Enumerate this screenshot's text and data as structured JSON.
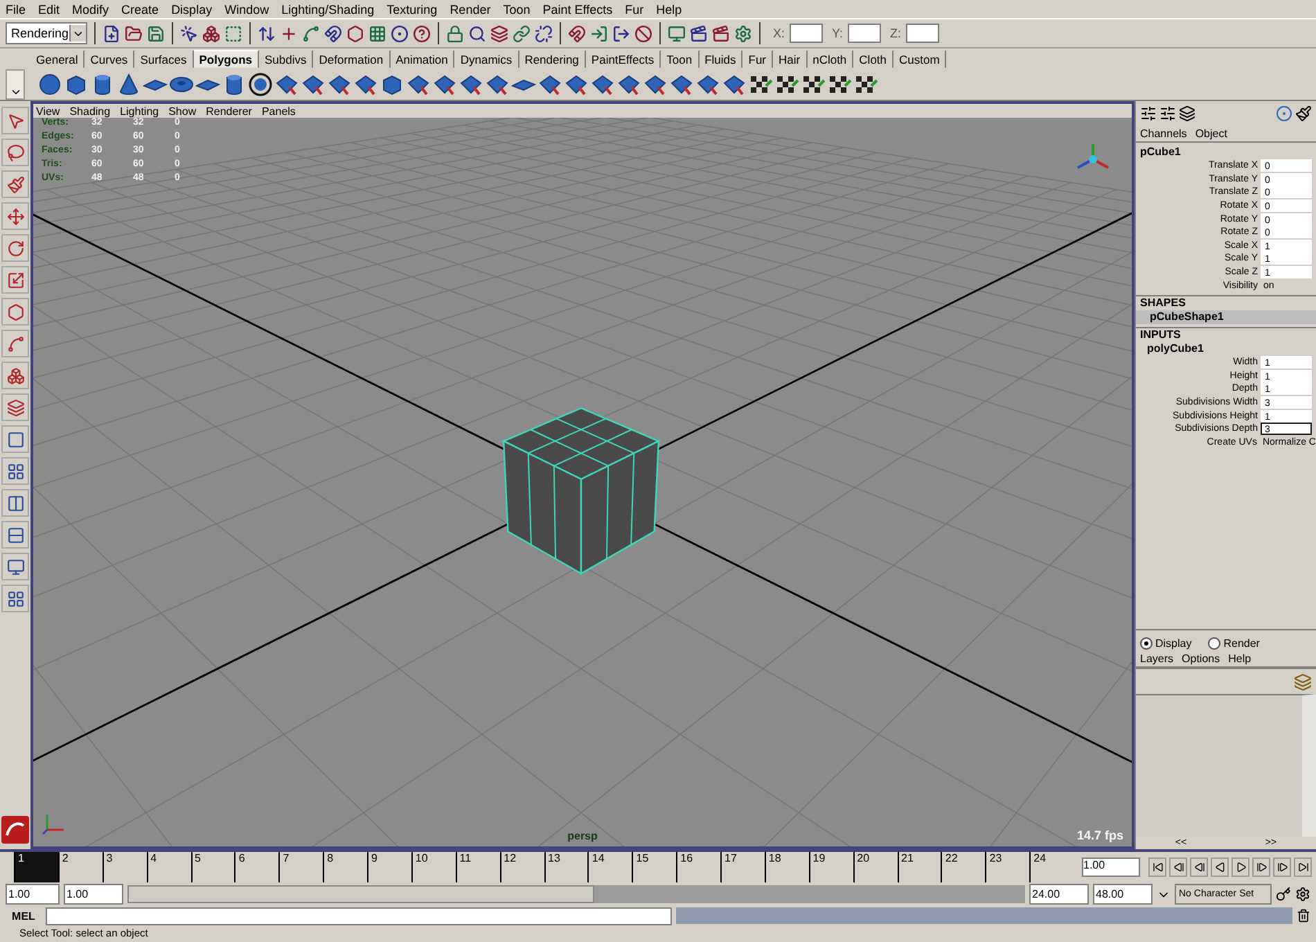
{
  "menu_bar": [
    "File",
    "Edit",
    "Modify",
    "Create",
    "Display",
    "Window",
    "Lighting/Shading",
    "Texturing",
    "Render",
    "Toon",
    "Paint Effects",
    "Fur",
    "Help"
  ],
  "status_line": {
    "mode": "Rendering",
    "coord_labels": [
      "X:",
      "Y:",
      "Z:"
    ]
  },
  "shelf_tabs": [
    {
      "label": "General",
      "selected": false
    },
    {
      "label": "Curves",
      "selected": false
    },
    {
      "label": "Surfaces",
      "selected": false
    },
    {
      "label": "Polygons",
      "selected": true
    },
    {
      "label": "Subdivs",
      "selected": false
    },
    {
      "label": "Deformation",
      "selected": false
    },
    {
      "label": "Animation",
      "selected": false
    },
    {
      "label": "Dynamics",
      "selected": false
    },
    {
      "label": "Rendering",
      "selected": false
    },
    {
      "label": "PaintEffects",
      "selected": false
    },
    {
      "label": "Toon",
      "selected": false
    },
    {
      "label": "Fluids",
      "selected": false
    },
    {
      "label": "Fur",
      "selected": false
    },
    {
      "label": "Hair",
      "selected": false
    },
    {
      "label": "nCloth",
      "selected": false
    },
    {
      "label": "Cloth",
      "selected": false
    },
    {
      "label": "Custom",
      "selected": false
    }
  ],
  "viewport": {
    "menu": [
      "View",
      "Shading",
      "Lighting",
      "Show",
      "Renderer",
      "Panels"
    ],
    "stats": [
      {
        "label": "Verts:",
        "values": [
          "32",
          "32",
          "0"
        ]
      },
      {
        "label": "Edges:",
        "values": [
          "60",
          "60",
          "0"
        ]
      },
      {
        "label": "Faces:",
        "values": [
          "30",
          "30",
          "0"
        ]
      },
      {
        "label": "Tris:",
        "values": [
          "60",
          "60",
          "0"
        ]
      },
      {
        "label": "UVs:",
        "values": [
          "48",
          "48",
          "0"
        ]
      }
    ],
    "camera": "persp",
    "fps": "14.7 fps"
  },
  "channel_box": {
    "menu": [
      "Channels",
      "Object"
    ],
    "node": "pCube1",
    "attributes": [
      {
        "label": "Translate X",
        "value": "0"
      },
      {
        "label": "Translate Y",
        "value": "0"
      },
      {
        "label": "Translate Z",
        "value": "0"
      },
      {
        "label": "Rotate X",
        "value": "0"
      },
      {
        "label": "Rotate Y",
        "value": "0"
      },
      {
        "label": "Rotate Z",
        "value": "0"
      },
      {
        "label": "Scale X",
        "value": "1"
      },
      {
        "label": "Scale Y",
        "value": "1"
      },
      {
        "label": "Scale Z",
        "value": "1"
      },
      {
        "label": "Visibility",
        "value": "on"
      }
    ],
    "shapes_header": "SHAPES",
    "shape": "pCubeShape1",
    "inputs_header": "INPUTS",
    "input_node": "polyCube1",
    "input_attributes": [
      {
        "label": "Width",
        "value": "1",
        "selected": false
      },
      {
        "label": "Height",
        "value": "1",
        "selected": false
      },
      {
        "label": "Depth",
        "value": "1",
        "selected": false
      },
      {
        "label": "Subdivisions Width",
        "value": "3",
        "selected": false
      },
      {
        "label": "Subdivisions Height",
        "value": "1",
        "selected": false
      },
      {
        "label": "Subdivisions Depth",
        "value": "3",
        "selected": true
      },
      {
        "label": "Create UVs",
        "value": "Normalize C",
        "selected": false
      }
    ]
  },
  "layer_editor": {
    "modes": [
      {
        "label": "Display",
        "selected": true
      },
      {
        "label": "Render",
        "selected": false
      }
    ],
    "menu": [
      "Layers",
      "Options",
      "Help"
    ],
    "scroll_buttons": [
      "<<",
      ">>"
    ]
  },
  "time_slider": {
    "frames": [
      {
        "label": "1",
        "selected": true
      },
      {
        "label": "2",
        "selected": false
      },
      {
        "label": "3",
        "selected": false
      },
      {
        "label": "4",
        "selected": false
      },
      {
        "label": "5",
        "selected": false
      },
      {
        "label": "6",
        "selected": false
      },
      {
        "label": "7",
        "selected": false
      },
      {
        "label": "8",
        "selected": false
      },
      {
        "label": "9",
        "selected": false
      },
      {
        "label": "10",
        "selected": false
      },
      {
        "label": "11",
        "selected": false
      },
      {
        "label": "12",
        "selected": false
      },
      {
        "label": "13",
        "selected": false
      },
      {
        "label": "14",
        "selected": false
      },
      {
        "label": "15",
        "selected": false
      },
      {
        "label": "16",
        "selected": false
      },
      {
        "label": "17",
        "selected": false
      },
      {
        "label": "18",
        "selected": false
      },
      {
        "label": "19",
        "selected": false
      },
      {
        "label": "20",
        "selected": false
      },
      {
        "label": "21",
        "selected": false
      },
      {
        "label": "22",
        "selected": false
      },
      {
        "label": "23",
        "selected": false
      },
      {
        "label": "24",
        "selected": false
      }
    ],
    "current_time": "1.00"
  },
  "range_slider": {
    "level": 0.52,
    "start": "1.00",
    "playback_start": "1.00",
    "playback_end": "24.00",
    "end": "48.00",
    "character_set": "No Character Set"
  },
  "command_line": {
    "label": "MEL"
  },
  "help_line": "Select Tool: select an object"
}
